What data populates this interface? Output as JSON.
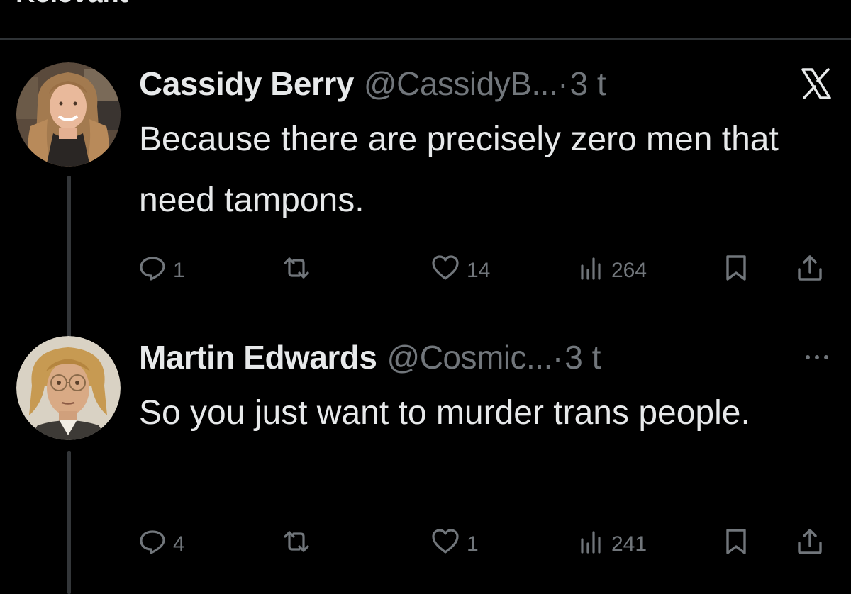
{
  "header_fragment": "Relevant",
  "colors": {
    "background": "#000000",
    "text_primary": "#e7e9ea",
    "text_secondary": "#71767b",
    "thread_line": "#333639"
  },
  "tweets": [
    {
      "name": "Cassidy Berry",
      "handle": "@CassidyB...",
      "separator": "·",
      "time": "3 t",
      "corner_icon": "x-logo-icon",
      "text": "Because there are precisely zero men that need tampons.",
      "actions": {
        "replies": "1",
        "reposts": "",
        "likes": "14",
        "views": "264"
      }
    },
    {
      "name": "Martin Edwards",
      "handle": "@Cosmic...",
      "separator": "·",
      "time": "3 t",
      "corner_icon": "more-options-icon",
      "text": "So you just want to murder trans people.",
      "actions": {
        "replies": "4",
        "reposts": "",
        "likes": "1",
        "views": "241"
      }
    }
  ]
}
